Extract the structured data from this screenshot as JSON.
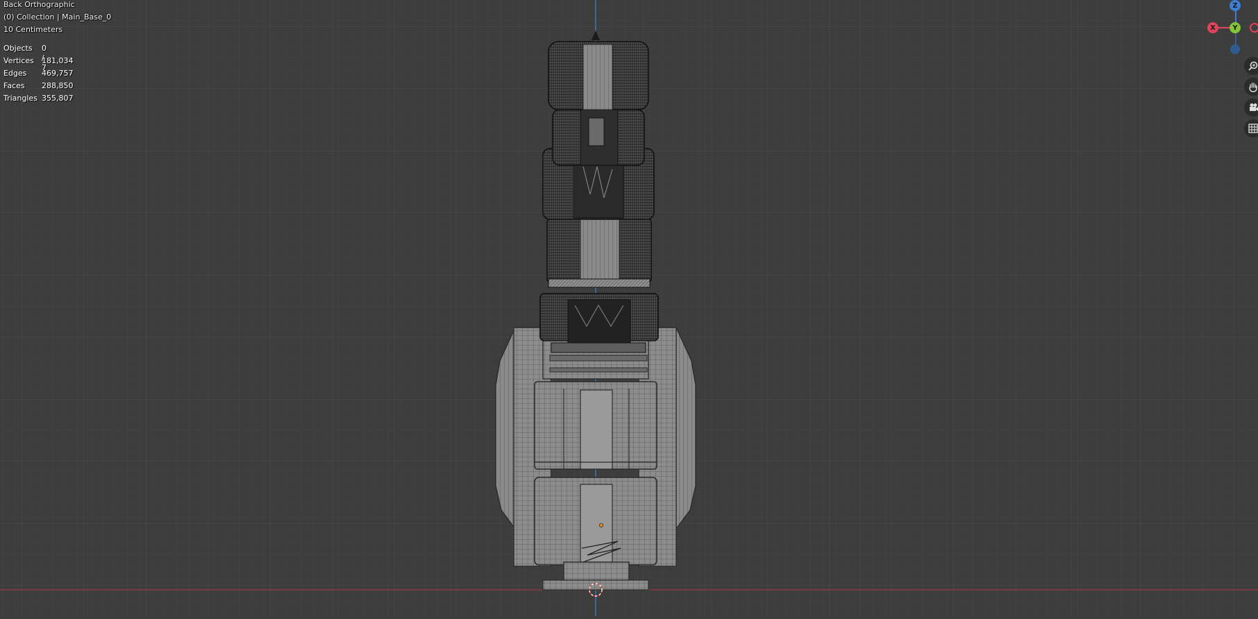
{
  "viewport": {
    "view_name": "Back Orthographic",
    "collection": "(0) Collection | Main_Base_0",
    "scale": "10 Centimeters"
  },
  "stats": [
    {
      "label": "Objects",
      "value": "0 / 7"
    },
    {
      "label": "Vertices",
      "value": "181,034"
    },
    {
      "label": "Edges",
      "value": "469,757"
    },
    {
      "label": "Faces",
      "value": "288,850"
    },
    {
      "label": "Triangles",
      "value": "355,807"
    }
  ],
  "gizmo": {
    "z_label": "Z",
    "x_label": "X",
    "y_label": "Y",
    "colors": {
      "x": "#e0435a",
      "y": "#86c43a",
      "z": "#3c7fd4"
    }
  },
  "nav_tools": {
    "zoom_icon": "magnifier-icon",
    "pan_icon": "hand-icon",
    "camera_icon": "camera-icon",
    "grid_icon": "grid-icon"
  },
  "colors": {
    "background": "#3d3d3d",
    "grid_minor": "#434343",
    "grid_major": "#4a4a4a",
    "axis_z": "#3f7fc4",
    "axis_x": "#a33d45",
    "mesh_fill": "#8f8f8f",
    "mesh_dark": "#1e1e1e"
  }
}
